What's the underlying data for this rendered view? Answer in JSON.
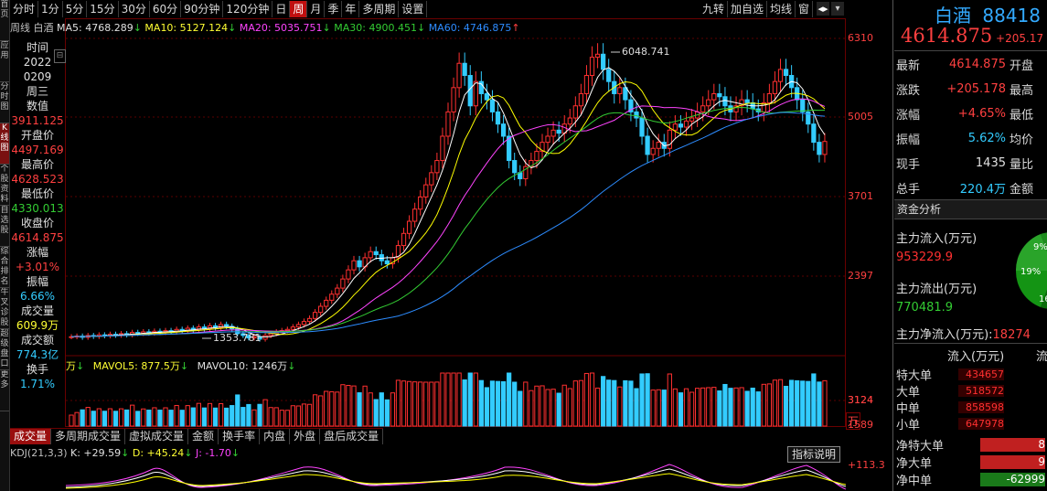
{
  "toolbar": {
    "periods": [
      "分时",
      "1分",
      "5分",
      "15分",
      "30分",
      "60分",
      "90分钟",
      "120分钟",
      "日",
      "周",
      "月",
      "季",
      "年",
      "多周期",
      "设置"
    ],
    "active_period": "周",
    "right_tools": [
      "九转",
      "加自选",
      "均线",
      "窗"
    ]
  },
  "left_tabs": [
    "首页",
    "应用",
    "分时图",
    "K线图",
    "个股资料",
    "自选股",
    "综合排名",
    "牛叉诊股",
    "超级盘口",
    "更多"
  ],
  "legend": {
    "period_label": "周线",
    "name": "白酒",
    "ma5": "MA5: 4768.289",
    "ma10": "MA10: 5127.124",
    "ma20": "MA20: 5035.751",
    "ma30": "MA30: 4900.451",
    "ma60": "MA60: 4746.875"
  },
  "info_panel": {
    "time_label": "时间",
    "year": "2022",
    "date": "0209",
    "weekday": "周三",
    "value_label": "数值",
    "value": "3911.125",
    "open_label": "开盘价",
    "open": "4497.169",
    "high_label": "最高价",
    "high": "4628.523",
    "low_label": "最低价",
    "low": "4330.013",
    "close_label": "收盘价",
    "close": "4614.875",
    "chg_label": "涨幅",
    "chg": "+3.01%",
    "amp_label": "振幅",
    "amp": "6.66%",
    "vol_label": "成交量",
    "vol": "609.9万",
    "amt_label": "成交额",
    "amt": "774.3亿",
    "turn_label": "换手",
    "turn": "1.71%"
  },
  "price_axis": [
    "6310",
    "5005",
    "3701",
    "2397"
  ],
  "annotations": {
    "high": "6048.741",
    "low": "1353.781"
  },
  "volume": {
    "unit": "万",
    "mavol5": "MAVOL5: 877.5万",
    "mavol10": "MAVOL10: 1246万",
    "axis": [
      "3124",
      "1589"
    ],
    "axis_unit": "万"
  },
  "bottom_tabs": [
    "成交量",
    "多周期成交量",
    "虚拟成交量",
    "金额",
    "换手率",
    "内盘",
    "外盘",
    "盘后成交量"
  ],
  "kdj": {
    "label": "KDJ(21,3,3)",
    "k": "K: +29.59",
    "d": "D: +45.24",
    "j": "J: -1.70",
    "axis": "+113.3",
    "button": "指标说明"
  },
  "quote": {
    "name": "白酒",
    "code": "88418",
    "price": "4614.875",
    "change": "+205.17",
    "rows": [
      {
        "k": "最新",
        "v": "4614.875",
        "k2": "开盘",
        "c": "up"
      },
      {
        "k": "涨跌",
        "v": "+205.178",
        "k2": "最高",
        "c": "up"
      },
      {
        "k": "涨幅",
        "v": "+4.65%",
        "k2": "最低",
        "c": "up"
      },
      {
        "k": "振幅",
        "v": "5.62%",
        "k2": "均价",
        "c": "cy"
      },
      {
        "k": "现手",
        "v": "1435",
        "k2": "量比",
        "c": "wh"
      },
      {
        "k": "总手",
        "v": "220.4万",
        "k2": "金额",
        "c": "cy"
      }
    ]
  },
  "fund": {
    "title": "资金分析",
    "inflow_label": "主力流入(万元)",
    "inflow": "953229.9",
    "outflow_label": "主力流出(万元)",
    "outflow": "770481.9",
    "net_label": "主力净流入(万元):",
    "net": "18274",
    "pie": [
      "9%",
      "19%",
      "16"
    ],
    "col1": "流入(万元)",
    "col2": "流",
    "rows": [
      {
        "k": "特大单",
        "v": "434657"
      },
      {
        "k": "大单",
        "v": "518572"
      },
      {
        "k": "中单",
        "v": "858598"
      },
      {
        "k": "小单",
        "v": "647978"
      }
    ],
    "net_rows": [
      {
        "k": "净特大单",
        "v": "8"
      },
      {
        "k": "净大单",
        "v": "9"
      },
      {
        "k": "净中单",
        "v": "-62999"
      }
    ]
  },
  "colors": {
    "up": "#ff3030",
    "down": "#33ccff",
    "ma5": "#ffffff",
    "ma10": "#ffff00",
    "ma20": "#ff44ff",
    "ma30": "#33cc33",
    "ma60": "#2d8cff"
  }
}
